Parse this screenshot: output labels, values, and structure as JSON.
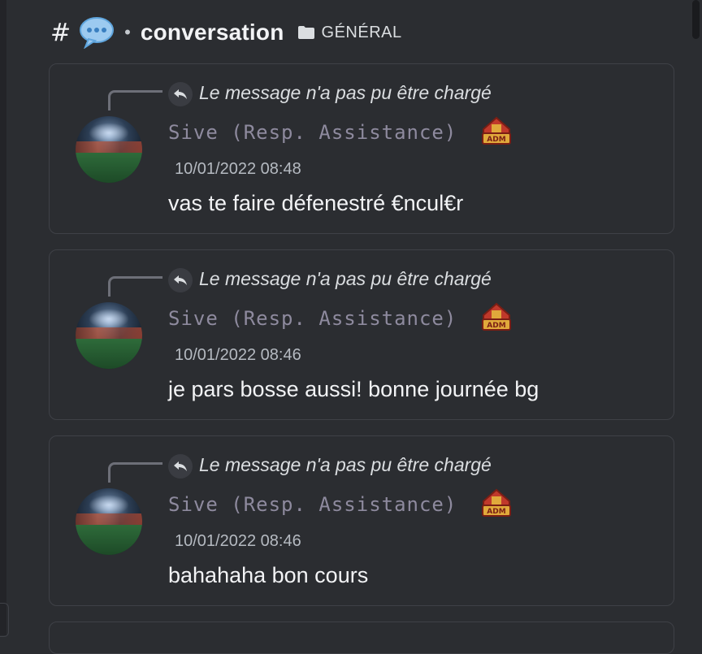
{
  "header": {
    "hash": "#",
    "bubble_icon": "speech-bubble-icon",
    "separator": "•",
    "channel": "conversation",
    "folder_icon": "folder-icon",
    "category": "GÉNÉRAL"
  },
  "messages": [
    {
      "reply_text": "Le message n'a pas pu être chargé",
      "username": "Sive (Resp. Assistance)",
      "badge": "ADM",
      "timestamp": "10/01/2022 08:48",
      "text": "vas te faire défenestré €ncul€r"
    },
    {
      "reply_text": "Le message n'a pas pu être chargé",
      "username": "Sive (Resp. Assistance)",
      "badge": "ADM",
      "timestamp": "10/01/2022 08:46",
      "text": "je pars bosse aussi! bonne journée bg"
    },
    {
      "reply_text": "Le message n'a pas pu être chargé",
      "username": "Sive (Resp. Assistance)",
      "badge": "ADM",
      "timestamp": "10/01/2022 08:46",
      "text": "bahahaha bon cours"
    }
  ],
  "colors": {
    "background": "#2b2d31",
    "card_border": "#3f4147",
    "username": "#8e8a9e",
    "badge_red": "#c0392b",
    "badge_gold": "#e0a93b"
  }
}
